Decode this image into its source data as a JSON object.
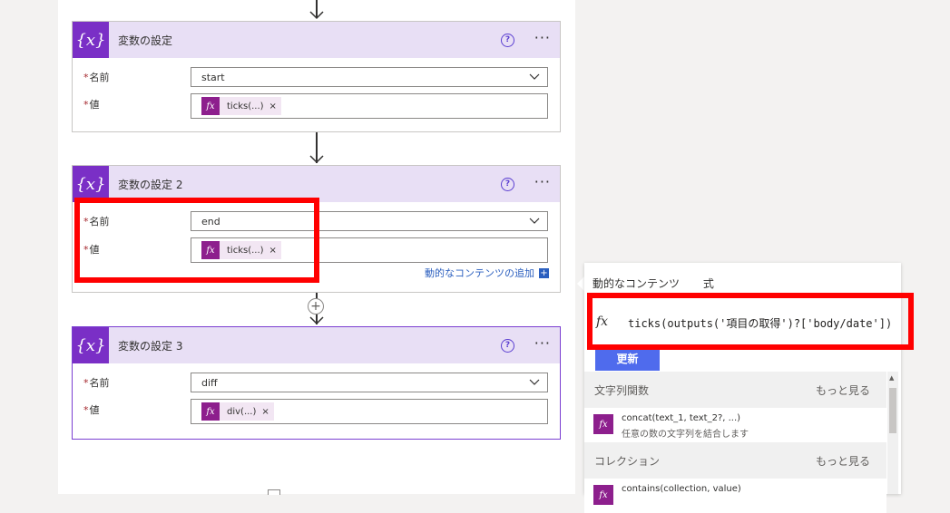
{
  "cards": [
    {
      "title": "変数の設定",
      "icon": "variable-icon",
      "icon_text": "{x}",
      "name_label": "名前",
      "name_value": "start",
      "value_label": "値",
      "token": "ticks(...)"
    },
    {
      "title": "変数の設定 2",
      "icon": "variable-icon",
      "icon_text": "{x}",
      "name_label": "名前",
      "name_value": "end",
      "value_label": "値",
      "token": "ticks(...)",
      "dynamic_link": "動的なコンテンツの追加"
    },
    {
      "title": "変数の設定 3",
      "icon": "variable-icon",
      "icon_text": "{x}",
      "name_label": "名前",
      "name_value": "diff",
      "value_label": "値",
      "token": "div(...)"
    }
  ],
  "common": {
    "required_mark": "*",
    "help": "?",
    "more": "···",
    "remove": "×",
    "fx": "fx",
    "plus": "+"
  },
  "panel": {
    "tabs": [
      "動的なコンテンツ",
      "式"
    ],
    "expression": "ticks(outputs('項目の取得')?['body/date'])",
    "update_button": "更新",
    "sections": [
      {
        "title": "文字列関数",
        "more": "もっと見る",
        "items": [
          {
            "name": "concat(text_1, text_2?, ...)",
            "desc": "任意の数の文字列を結合します"
          }
        ]
      },
      {
        "title": "コレクション",
        "more": "もっと見る",
        "items": [
          {
            "name": "contains(collection, value)",
            "desc": ""
          }
        ]
      }
    ]
  },
  "colors": {
    "header_bg": "#e8dff5",
    "icon_bg": "#7a2fc6",
    "token_icon": "#8d1f8d",
    "highlight": "#ff0000",
    "update_button": "#4f6bed",
    "link": "#2b5fbf"
  }
}
